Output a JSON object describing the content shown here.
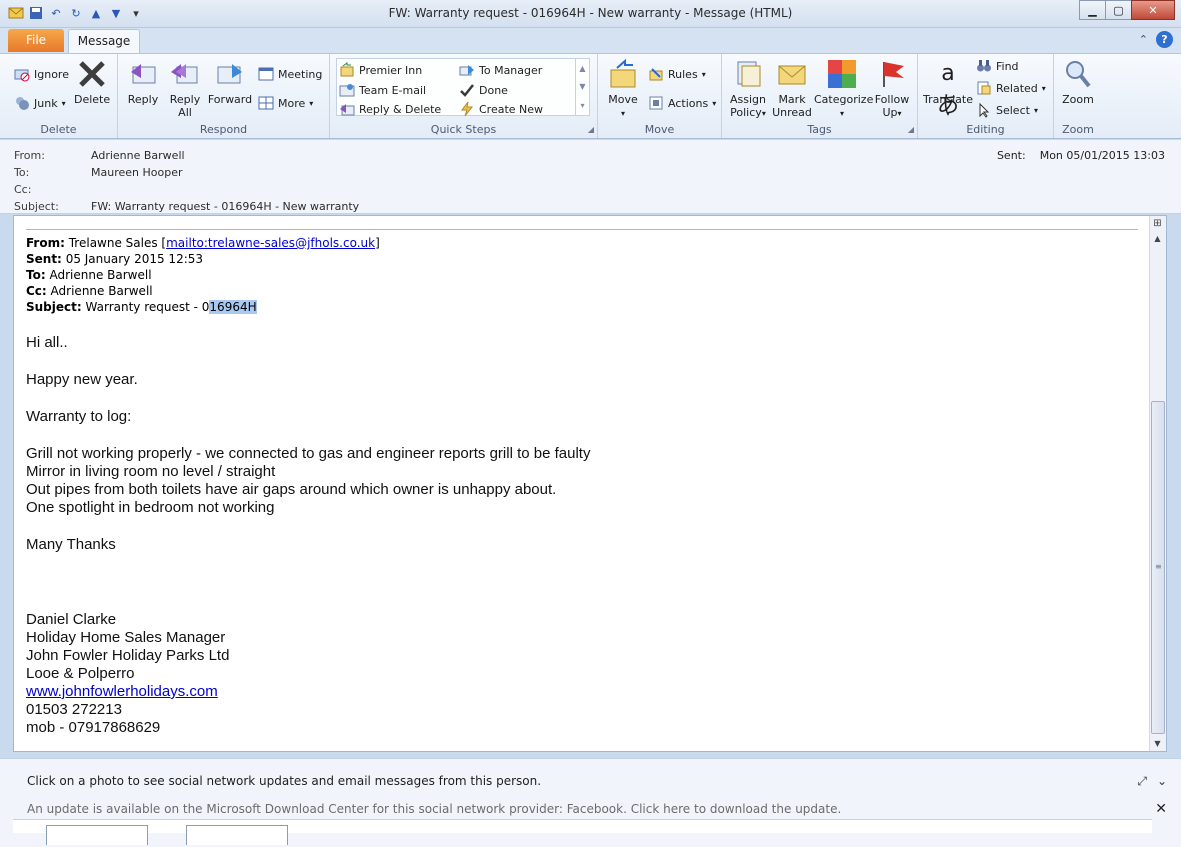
{
  "window": {
    "title": "FW: Warranty request - 016964H - New warranty - Message (HTML)"
  },
  "tabs": {
    "file": "File",
    "message": "Message"
  },
  "ribbon": {
    "delete_group": {
      "label": "Delete",
      "ignore": "Ignore",
      "junk": "Junk",
      "delete": "Delete"
    },
    "respond_group": {
      "label": "Respond",
      "reply": "Reply",
      "reply_all_1": "Reply",
      "reply_all_2": "All",
      "forward": "Forward",
      "meeting": "Meeting",
      "more": "More"
    },
    "quick_steps": {
      "label": "Quick Steps",
      "items": [
        "Premier Inn",
        "To Manager",
        "Team E-mail",
        "Done",
        "Reply & Delete",
        "Create New"
      ]
    },
    "move_group": {
      "label": "Move",
      "move": "Move",
      "rules": "Rules",
      "actions": "Actions"
    },
    "tags_group": {
      "label": "Tags",
      "assign_1": "Assign",
      "assign_2": "Policy",
      "mark_1": "Mark",
      "mark_2": "Unread",
      "categorize": "Categorize",
      "follow_1": "Follow",
      "follow_2": "Up"
    },
    "editing_group": {
      "label": "Editing",
      "translate": "Translate",
      "find": "Find",
      "related": "Related",
      "select": "Select"
    },
    "zoom_group": {
      "label": "Zoom",
      "zoom": "Zoom"
    }
  },
  "header": {
    "from_label": "From:",
    "from": "Adrienne Barwell",
    "to_label": "To:",
    "to": "Maureen Hooper",
    "cc_label": "Cc:",
    "subject_label": "Subject:",
    "subject": "FW: Warranty request - 016964H - New warranty",
    "sent_label": "Sent:",
    "sent": "Mon 05/01/2015 13:03"
  },
  "original": {
    "from_label": "From:",
    "from_name": "Trelawne Sales",
    "from_link": "mailto:trelawne-sales@jfhols.co.uk",
    "sent_label": "Sent:",
    "sent": "05 January 2015 12:53",
    "to_label": "To:",
    "to": "Adrienne Barwell",
    "cc_label": "Cc:",
    "cc": "Adrienne Barwell",
    "subject_label": "Subject:",
    "subject_prefix": "Warranty request - 0",
    "subject_highlight": "16964H"
  },
  "message": {
    "greeting": "Hi all..",
    "new_year": "Happy new year.",
    "intro": "Warranty to log:",
    "items": [
      "Grill not working properly - we connected to gas and engineer reports grill to be faulty",
      "Mirror in living room no level / straight",
      "Out pipes from both toilets have air gaps around which owner is unhappy about.",
      "One spotlight in bedroom not working"
    ],
    "thanks": "Many Thanks",
    "signature": [
      "Daniel Clarke",
      "Holiday Home Sales Manager",
      "John Fowler Holiday Parks Ltd",
      "Looe & Polperro"
    ],
    "website": "www.johnfowlerholidays.com",
    "phone": "01503 272213",
    "mobile": "mob - 07917868629"
  },
  "social": {
    "line1": "Click on a photo to see social network updates and email messages from this person.",
    "line2": "An update is available on the Microsoft Download Center for this social network provider: Facebook. Click here to download the update."
  },
  "colors": {
    "file_tab": "#e8782a",
    "link": "#0000cc",
    "highlight": "#a8c9f0"
  }
}
